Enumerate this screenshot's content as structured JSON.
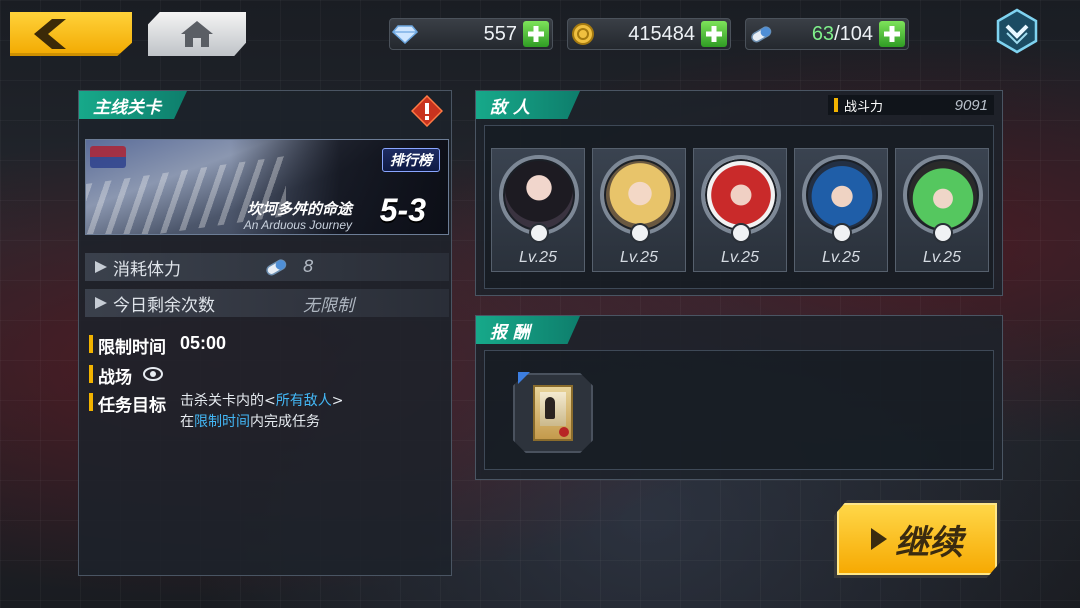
{
  "topbar": {
    "gems": "557",
    "gold": "415484",
    "stamina_current": "63",
    "stamina_max": "/104"
  },
  "stage": {
    "section_label": "主线关卡",
    "ranking_label": "排行榜",
    "title_cn": "坎坷多舛的命途",
    "title_en": "An Arduous Journey",
    "number": "5-3",
    "cost_label": "消耗体力",
    "cost_value": "8",
    "remaining_label": "今日剩余次数",
    "remaining_value": "无限制",
    "time_limit_label": "限制时间",
    "time_limit_value": "05:00",
    "battlefield_label": "战场",
    "objective_label": "任务目标",
    "objective_line1_prefix": "击杀关卡内的<",
    "objective_line1_link": "所有敌人",
    "objective_line1_suffix": ">",
    "objective_line2_prefix": "在",
    "objective_line2_link": "限制时间",
    "objective_line2_suffix": "内完成任务"
  },
  "enemies": {
    "section_label": "敌 人",
    "power_label": "战斗力",
    "power_value": "9091",
    "list": [
      {
        "level": "Lv.25"
      },
      {
        "level": "Lv.25"
      },
      {
        "level": "Lv.25"
      },
      {
        "level": "Lv.25"
      },
      {
        "level": "Lv.25"
      }
    ]
  },
  "reward": {
    "section_label": "报 酬"
  },
  "actions": {
    "continue_label": "继续"
  },
  "colors": {
    "accent_teal": "#17a98a",
    "accent_gold": "#f2b300",
    "link_blue": "#43b7f5",
    "plus_green": "#2f9c24"
  }
}
